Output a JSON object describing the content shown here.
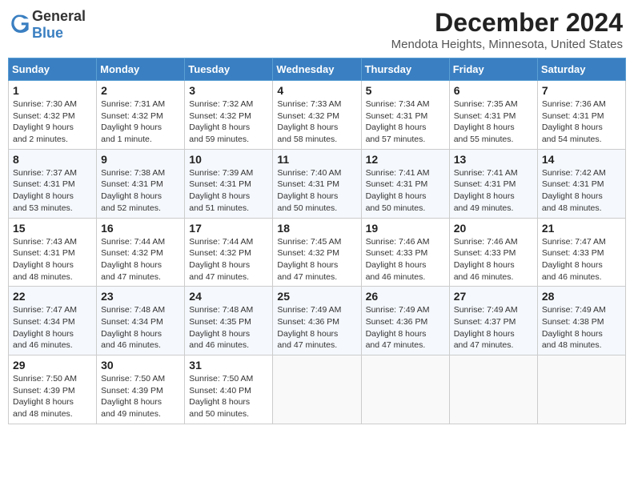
{
  "header": {
    "logo_general": "General",
    "logo_blue": "Blue",
    "title": "December 2024",
    "subtitle": "Mendota Heights, Minnesota, United States"
  },
  "calendar": {
    "days_of_week": [
      "Sunday",
      "Monday",
      "Tuesday",
      "Wednesday",
      "Thursday",
      "Friday",
      "Saturday"
    ],
    "weeks": [
      [
        null,
        {
          "day": "2",
          "sunrise": "7:31 AM",
          "sunset": "4:32 PM",
          "daylight": "9 hours and 1 minute."
        },
        {
          "day": "3",
          "sunrise": "7:32 AM",
          "sunset": "4:32 PM",
          "daylight": "8 hours and 59 minutes."
        },
        {
          "day": "4",
          "sunrise": "7:33 AM",
          "sunset": "4:32 PM",
          "daylight": "8 hours and 58 minutes."
        },
        {
          "day": "5",
          "sunrise": "7:34 AM",
          "sunset": "4:31 PM",
          "daylight": "8 hours and 57 minutes."
        },
        {
          "day": "6",
          "sunrise": "7:35 AM",
          "sunset": "4:31 PM",
          "daylight": "8 hours and 55 minutes."
        },
        {
          "day": "7",
          "sunrise": "7:36 AM",
          "sunset": "4:31 PM",
          "daylight": "8 hours and 54 minutes."
        }
      ],
      [
        {
          "day": "1",
          "sunrise": "7:30 AM",
          "sunset": "4:32 PM",
          "daylight": "9 hours and 2 minutes."
        },
        {
          "day": "9",
          "sunrise": "7:38 AM",
          "sunset": "4:31 PM",
          "daylight": "8 hours and 52 minutes."
        },
        {
          "day": "10",
          "sunrise": "7:39 AM",
          "sunset": "4:31 PM",
          "daylight": "8 hours and 51 minutes."
        },
        {
          "day": "11",
          "sunrise": "7:40 AM",
          "sunset": "4:31 PM",
          "daylight": "8 hours and 50 minutes."
        },
        {
          "day": "12",
          "sunrise": "7:41 AM",
          "sunset": "4:31 PM",
          "daylight": "8 hours and 50 minutes."
        },
        {
          "day": "13",
          "sunrise": "7:41 AM",
          "sunset": "4:31 PM",
          "daylight": "8 hours and 49 minutes."
        },
        {
          "day": "14",
          "sunrise": "7:42 AM",
          "sunset": "4:31 PM",
          "daylight": "8 hours and 48 minutes."
        }
      ],
      [
        {
          "day": "8",
          "sunrise": "7:37 AM",
          "sunset": "4:31 PM",
          "daylight": "8 hours and 53 minutes."
        },
        {
          "day": "16",
          "sunrise": "7:44 AM",
          "sunset": "4:32 PM",
          "daylight": "8 hours and 47 minutes."
        },
        {
          "day": "17",
          "sunrise": "7:44 AM",
          "sunset": "4:32 PM",
          "daylight": "8 hours and 47 minutes."
        },
        {
          "day": "18",
          "sunrise": "7:45 AM",
          "sunset": "4:32 PM",
          "daylight": "8 hours and 47 minutes."
        },
        {
          "day": "19",
          "sunrise": "7:46 AM",
          "sunset": "4:33 PM",
          "daylight": "8 hours and 46 minutes."
        },
        {
          "day": "20",
          "sunrise": "7:46 AM",
          "sunset": "4:33 PM",
          "daylight": "8 hours and 46 minutes."
        },
        {
          "day": "21",
          "sunrise": "7:47 AM",
          "sunset": "4:33 PM",
          "daylight": "8 hours and 46 minutes."
        }
      ],
      [
        {
          "day": "15",
          "sunrise": "7:43 AM",
          "sunset": "4:31 PM",
          "daylight": "8 hours and 48 minutes."
        },
        {
          "day": "23",
          "sunrise": "7:48 AM",
          "sunset": "4:34 PM",
          "daylight": "8 hours and 46 minutes."
        },
        {
          "day": "24",
          "sunrise": "7:48 AM",
          "sunset": "4:35 PM",
          "daylight": "8 hours and 46 minutes."
        },
        {
          "day": "25",
          "sunrise": "7:49 AM",
          "sunset": "4:36 PM",
          "daylight": "8 hours and 47 minutes."
        },
        {
          "day": "26",
          "sunrise": "7:49 AM",
          "sunset": "4:36 PM",
          "daylight": "8 hours and 47 minutes."
        },
        {
          "day": "27",
          "sunrise": "7:49 AM",
          "sunset": "4:37 PM",
          "daylight": "8 hours and 47 minutes."
        },
        {
          "day": "28",
          "sunrise": "7:49 AM",
          "sunset": "4:38 PM",
          "daylight": "8 hours and 48 minutes."
        }
      ],
      [
        {
          "day": "22",
          "sunrise": "7:47 AM",
          "sunset": "4:34 PM",
          "daylight": "8 hours and 46 minutes."
        },
        {
          "day": "30",
          "sunrise": "7:50 AM",
          "sunset": "4:39 PM",
          "daylight": "8 hours and 49 minutes."
        },
        {
          "day": "31",
          "sunrise": "7:50 AM",
          "sunset": "4:40 PM",
          "daylight": "8 hours and 50 minutes."
        },
        null,
        null,
        null,
        null
      ],
      [
        {
          "day": "29",
          "sunrise": "7:50 AM",
          "sunset": "4:39 PM",
          "daylight": "8 hours and 48 minutes."
        },
        null,
        null,
        null,
        null,
        null,
        null
      ]
    ]
  }
}
